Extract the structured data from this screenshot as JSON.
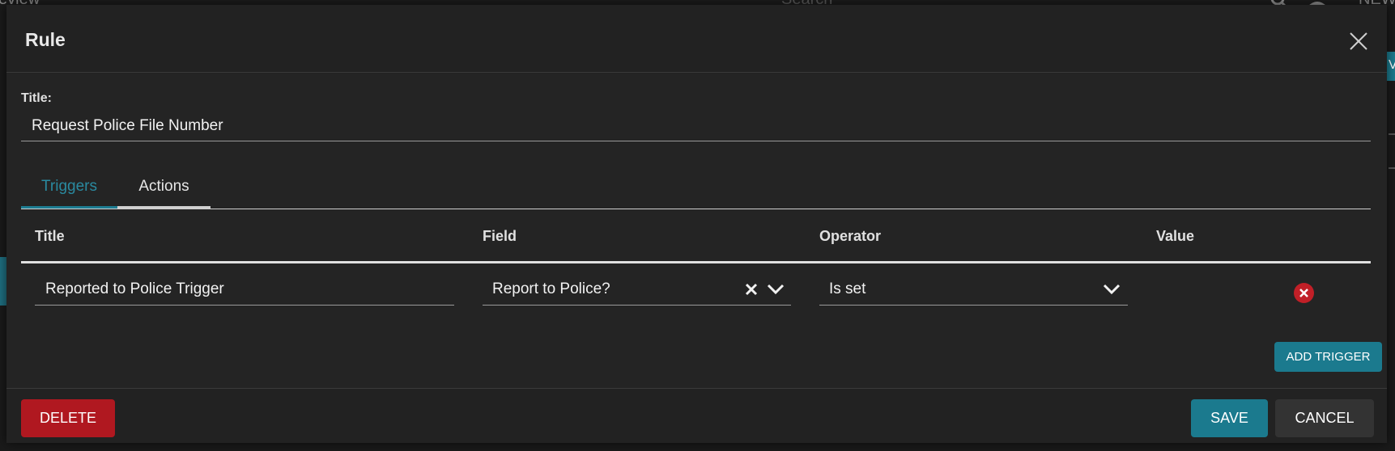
{
  "background": {
    "left_text": "eview",
    "search_placeholder": "Search",
    "right_text": "NEW",
    "teal_tab_text": "V"
  },
  "dialog": {
    "title": "Rule",
    "form": {
      "title_label": "Title:",
      "title_value": "Request Police File Number"
    },
    "tabs": [
      {
        "label": "Triggers",
        "active": true
      },
      {
        "label": "Actions",
        "active": false
      }
    ],
    "table": {
      "columns": [
        "Title",
        "Field",
        "Operator",
        "Value"
      ],
      "rows": [
        {
          "title": "Reported to Police Trigger",
          "field": "Report to Police?",
          "operator": "Is set",
          "value": ""
        }
      ]
    },
    "add_trigger_label": "ADD TRIGGER",
    "footer": {
      "delete_label": "DELETE",
      "save_label": "SAVE",
      "cancel_label": "CANCEL"
    }
  },
  "colors": {
    "accent": "#1b7a8e",
    "danger": "#b01820",
    "surface": "#222222"
  }
}
